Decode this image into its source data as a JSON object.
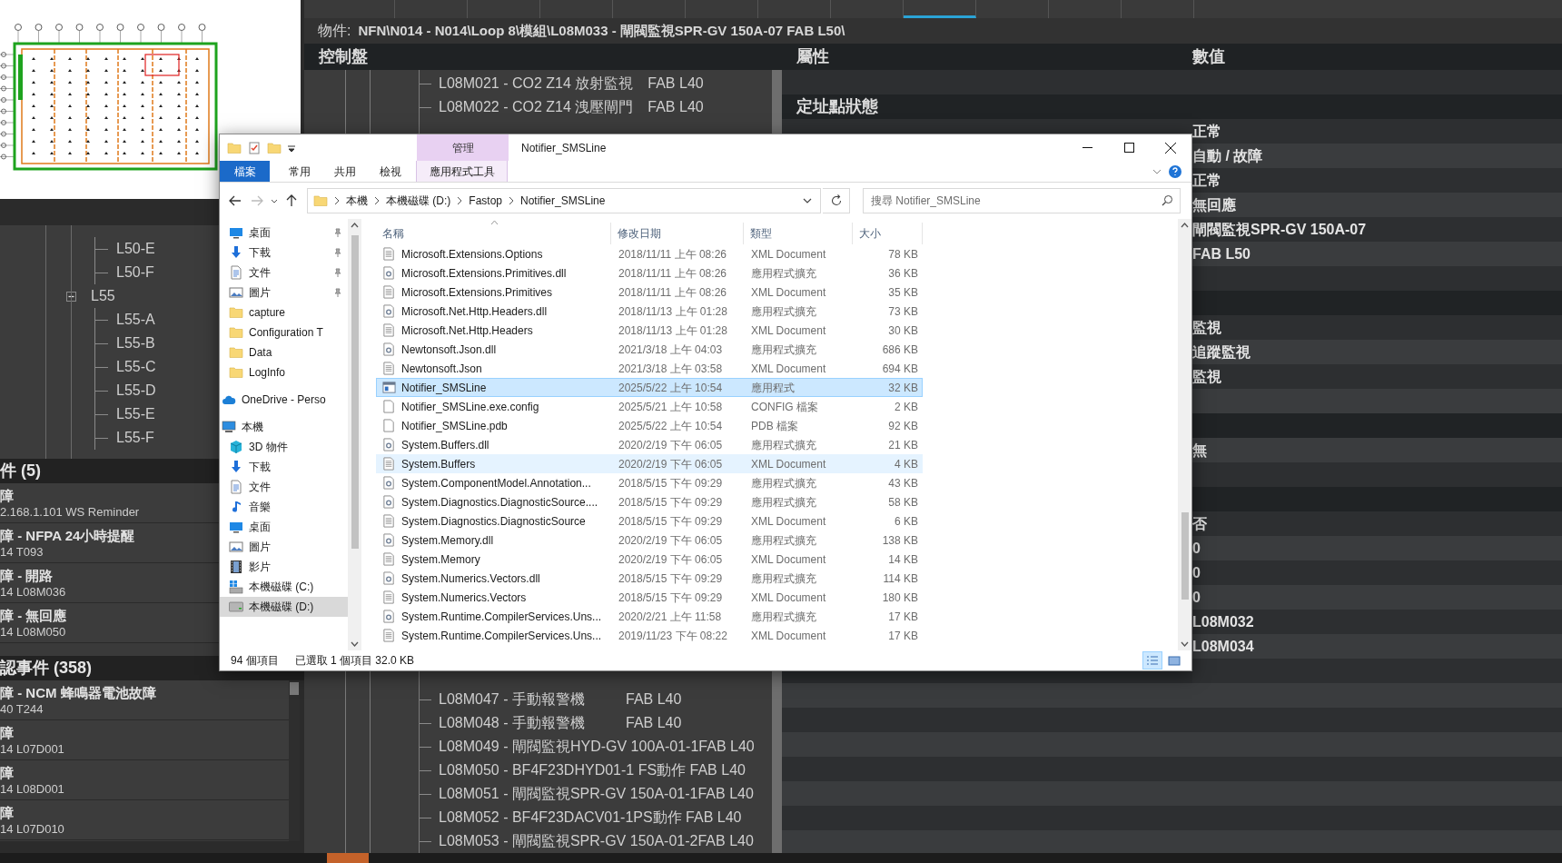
{
  "tabs": [
    {
      "selected": false
    },
    {
      "selected": false
    },
    {
      "selected": false
    },
    {
      "selected": false
    },
    {
      "selected": false
    },
    {
      "selected": false
    },
    {
      "selected": false
    },
    {
      "selected": false
    },
    {
      "selected": true
    },
    {
      "selected": false
    },
    {
      "selected": false
    },
    {
      "selected": false
    }
  ],
  "location_tree": {
    "items": [
      {
        "children": [
          {
            "label": "L50-E"
          },
          {
            "label": "L50-F"
          }
        ]
      },
      {
        "label": "L55",
        "expanded": true,
        "children": [
          {
            "label": "L55-A"
          },
          {
            "label": "L55-B"
          },
          {
            "label": "L55-C"
          },
          {
            "label": "L55-D"
          },
          {
            "label": "L55-E"
          },
          {
            "label": "L55-F"
          }
        ]
      }
    ]
  },
  "active_events": {
    "title": "件 (5)",
    "items": [
      {
        "title": "障",
        "detail": "2.168.1.101 WS Reminder"
      },
      {
        "title": "障 - NFPA 24小時提醒",
        "detail": "14 T093"
      },
      {
        "title": "障 - 開路",
        "detail": "14 L08M036"
      },
      {
        "title": "障 - 無回應",
        "detail": "14 L08M050"
      }
    ]
  },
  "unacknowledged_events": {
    "title": "認事件 (358)",
    "items": [
      {
        "title": "障 - NCM 蜂鳴器電池故障",
        "detail": "40 T244"
      },
      {
        "title": "障",
        "detail": "14 L07D001"
      },
      {
        "title": "障",
        "detail": "14 L08D001"
      },
      {
        "title": "障",
        "detail": "14 L07D010"
      }
    ]
  },
  "object_path": {
    "label": "物件:",
    "path": "NFN\\N014 - N014\\Loop 8\\模組\\L08M033 - 閘閥監視SPR-GV 150A-07  FAB L50\\"
  },
  "panel_tree": {
    "title": "控制盤",
    "top_items": [
      {
        "label": "L08M021 - CO2 Z14 放射監視",
        "area": "FAB L40"
      },
      {
        "label": "L08M022 - CO2 Z14 洩壓閘門",
        "area": "FAB L40"
      }
    ],
    "bottom_items": [
      {
        "label": "L08M047 - 手動報警機",
        "area": "FAB L40"
      },
      {
        "label": "L08M048 - 手動報警機",
        "area": "FAB L40"
      },
      {
        "label": "L08M049 - 閘閥監視HYD-GV 100A-01-1FAB L40"
      },
      {
        "label": "L08M050 - BF4F23DHYD01-1 FS動作 FAB L40"
      },
      {
        "label": "L08M051 - 閘閥監視SPR-GV 150A-01-1FAB L40"
      },
      {
        "label": "L08M052 - BF4F23DACV01-1PS動作  FAB L40"
      },
      {
        "label": "L08M053 - 閘閥監視SPR-GV 150A-01-2FAB L40"
      }
    ]
  },
  "properties": {
    "columns": [
      "屬性",
      "數值"
    ],
    "rows": [
      {
        "kind": "blank"
      },
      {
        "kind": "section",
        "label": "定址點狀態"
      },
      {
        "kind": "row",
        "value": "正常"
      },
      {
        "kind": "row",
        "value": "自動 / 故障"
      },
      {
        "kind": "row",
        "value": "正常"
      },
      {
        "kind": "row",
        "value": "無回應"
      },
      {
        "kind": "row",
        "value": "閘閥監視SPR-GV 150A-07"
      },
      {
        "kind": "row",
        "value": "FAB L50"
      },
      {
        "kind": "blank"
      },
      {
        "kind": "section"
      },
      {
        "kind": "row",
        "value": "監視"
      },
      {
        "kind": "row",
        "value": "追蹤監視"
      },
      {
        "kind": "row",
        "value": "監視"
      },
      {
        "kind": "blank"
      },
      {
        "kind": "section"
      },
      {
        "kind": "row",
        "value": "無"
      },
      {
        "kind": "blank"
      },
      {
        "kind": "section"
      },
      {
        "kind": "row",
        "value": "否"
      },
      {
        "kind": "row",
        "value": "0"
      },
      {
        "kind": "row",
        "value": "0"
      },
      {
        "kind": "row",
        "value": "0"
      },
      {
        "kind": "row",
        "value": "L08M032"
      },
      {
        "kind": "row",
        "value": "L08M034"
      }
    ]
  },
  "explorer": {
    "title": "Notifier_SMSLine",
    "context_tab": "管理",
    "ribbon_tabs": [
      {
        "label": "檔案",
        "kind": "file"
      },
      {
        "label": "常用",
        "kind": "plain"
      },
      {
        "label": "共用",
        "kind": "plain"
      },
      {
        "label": "檢視",
        "kind": "plain"
      },
      {
        "label": "應用程式工具",
        "kind": "context"
      }
    ],
    "breadcrumb": [
      "本機",
      "本機磁碟 (D:)",
      "Fastop",
      "Notifier_SMSLine"
    ],
    "search": {
      "placeholder": "搜尋 Notifier_SMSLine"
    },
    "nav": [
      {
        "children": [
          {
            "label": "桌面",
            "kind": "desktop",
            "pinned": true,
            "selected": false
          },
          {
            "label": "下載",
            "kind": "download",
            "pinned": true,
            "selected": false
          },
          {
            "label": "文件",
            "kind": "document",
            "pinned": true,
            "selected": false
          },
          {
            "label": "圖片",
            "kind": "picture",
            "pinned": true,
            "selected": false
          },
          {
            "label": "capture",
            "kind": "folder",
            "pinned": false,
            "selected": false
          },
          {
            "label": "Configuration T",
            "kind": "folder",
            "pinned": false,
            "selected": false
          },
          {
            "label": "Data",
            "kind": "folder",
            "pinned": false,
            "selected": false
          },
          {
            "label": "LogInfo",
            "kind": "folder",
            "pinned": false,
            "selected": false
          }
        ]
      },
      {
        "label": "OneDrive - Perso",
        "kind": "cloud",
        "pinned": false,
        "selected": false
      },
      {
        "label": "本機",
        "kind": "pc",
        "pinned": false,
        "selected": false,
        "children": [
          {
            "label": "3D 物件",
            "kind": "cube",
            "pinned": false,
            "selected": false
          },
          {
            "label": "下載",
            "kind": "download",
            "pinned": false,
            "selected": false
          },
          {
            "label": "文件",
            "kind": "document",
            "pinned": false,
            "selected": false
          },
          {
            "label": "音樂",
            "kind": "music",
            "pinned": false,
            "selected": false
          },
          {
            "label": "桌面",
            "kind": "desktop",
            "pinned": false,
            "selected": false
          },
          {
            "label": "圖片",
            "kind": "picture",
            "pinned": false,
            "selected": false
          },
          {
            "label": "影片",
            "kind": "video",
            "pinned": false,
            "selected": false
          },
          {
            "label": "本機磁碟 (C:)",
            "kind": "system_drive",
            "pinned": false,
            "selected": false
          },
          {
            "label": "本機磁碟 (D:)",
            "kind": "drive",
            "pinned": false,
            "selected": true
          }
        ]
      }
    ],
    "columns": [
      "名稱",
      "修改日期",
      "類型",
      "大小"
    ],
    "files": [
      {
        "name": "Microsoft.Extensions.Options",
        "modified": "2018/11/11 上午 08:26",
        "type": "XML Document",
        "size": "78 KB",
        "kind": "xml",
        "selected": false,
        "hovered": false
      },
      {
        "name": "Microsoft.Extensions.Primitives.dll",
        "modified": "2018/11/11 上午 08:26",
        "type": "應用程式擴充",
        "size": "36 KB",
        "kind": "dll",
        "selected": false,
        "hovered": false
      },
      {
        "name": "Microsoft.Extensions.Primitives",
        "modified": "2018/11/11 上午 08:26",
        "type": "XML Document",
        "size": "35 KB",
        "kind": "xml",
        "selected": false,
        "hovered": false
      },
      {
        "name": "Microsoft.Net.Http.Headers.dll",
        "modified": "2018/11/13 上午 01:28",
        "type": "應用程式擴充",
        "size": "73 KB",
        "kind": "dll",
        "selected": false,
        "hovered": false
      },
      {
        "name": "Microsoft.Net.Http.Headers",
        "modified": "2018/11/13 上午 01:28",
        "type": "XML Document",
        "size": "30 KB",
        "kind": "xml",
        "selected": false,
        "hovered": false
      },
      {
        "name": "Newtonsoft.Json.dll",
        "modified": "2021/3/18 上午 04:03",
        "type": "應用程式擴充",
        "size": "686 KB",
        "kind": "dll",
        "selected": false,
        "hovered": false
      },
      {
        "name": "Newtonsoft.Json",
        "modified": "2021/3/18 上午 03:58",
        "type": "XML Document",
        "size": "694 KB",
        "kind": "xml",
        "selected": false,
        "hovered": false
      },
      {
        "name": "Notifier_SMSLine",
        "modified": "2025/5/22 上午 10:54",
        "type": "應用程式",
        "size": "32 KB",
        "kind": "app",
        "selected": true,
        "hovered": false
      },
      {
        "name": "Notifier_SMSLine.exe.config",
        "modified": "2025/5/21 上午 10:58",
        "type": "CONFIG 檔案",
        "size": "2 KB",
        "kind": "file",
        "selected": false,
        "hovered": false
      },
      {
        "name": "Notifier_SMSLine.pdb",
        "modified": "2025/5/22 上午 10:54",
        "type": "PDB 檔案",
        "size": "92 KB",
        "kind": "file",
        "selected": false,
        "hovered": false
      },
      {
        "name": "System.Buffers.dll",
        "modified": "2020/2/19 下午 06:05",
        "type": "應用程式擴充",
        "size": "21 KB",
        "kind": "dll",
        "selected": false,
        "hovered": false
      },
      {
        "name": "System.Buffers",
        "modified": "2020/2/19 下午 06:05",
        "type": "XML Document",
        "size": "4 KB",
        "kind": "xml",
        "selected": false,
        "hovered": true
      },
      {
        "name": "System.ComponentModel.Annotation...",
        "modified": "2018/5/15 下午 09:29",
        "type": "應用程式擴充",
        "size": "43 KB",
        "kind": "dll",
        "selected": false,
        "hovered": false
      },
      {
        "name": "System.Diagnostics.DiagnosticSource....",
        "modified": "2018/5/15 下午 09:29",
        "type": "應用程式擴充",
        "size": "58 KB",
        "kind": "dll",
        "selected": false,
        "hovered": false
      },
      {
        "name": "System.Diagnostics.DiagnosticSource",
        "modified": "2018/5/15 下午 09:29",
        "type": "XML Document",
        "size": "6 KB",
        "kind": "xml",
        "selected": false,
        "hovered": false
      },
      {
        "name": "System.Memory.dll",
        "modified": "2020/2/19 下午 06:05",
        "type": "應用程式擴充",
        "size": "138 KB",
        "kind": "dll",
        "selected": false,
        "hovered": false
      },
      {
        "name": "System.Memory",
        "modified": "2020/2/19 下午 06:05",
        "type": "XML Document",
        "size": "14 KB",
        "kind": "xml",
        "selected": false,
        "hovered": false
      },
      {
        "name": "System.Numerics.Vectors.dll",
        "modified": "2018/5/15 下午 09:29",
        "type": "應用程式擴充",
        "size": "114 KB",
        "kind": "dll",
        "selected": false,
        "hovered": false
      },
      {
        "name": "System.Numerics.Vectors",
        "modified": "2018/5/15 下午 09:29",
        "type": "XML Document",
        "size": "180 KB",
        "kind": "xml",
        "selected": false,
        "hovered": false
      },
      {
        "name": "System.Runtime.CompilerServices.Uns...",
        "modified": "2020/2/21 上午 11:58",
        "type": "應用程式擴充",
        "size": "17 KB",
        "kind": "dll",
        "selected": false,
        "hovered": false
      },
      {
        "name": "System.Runtime.CompilerServices.Uns...",
        "modified": "2019/11/23 下午 08:22",
        "type": "XML Document",
        "size": "17 KB",
        "kind": "xml",
        "selected": false,
        "hovered": false
      }
    ],
    "status": {
      "count": "94 個項目",
      "selection": "已選取 1 個項目  32.0 KB"
    },
    "views": [
      {
        "kind": "details",
        "selected": true
      },
      {
        "kind": "thumbnails",
        "selected": false
      }
    ]
  }
}
